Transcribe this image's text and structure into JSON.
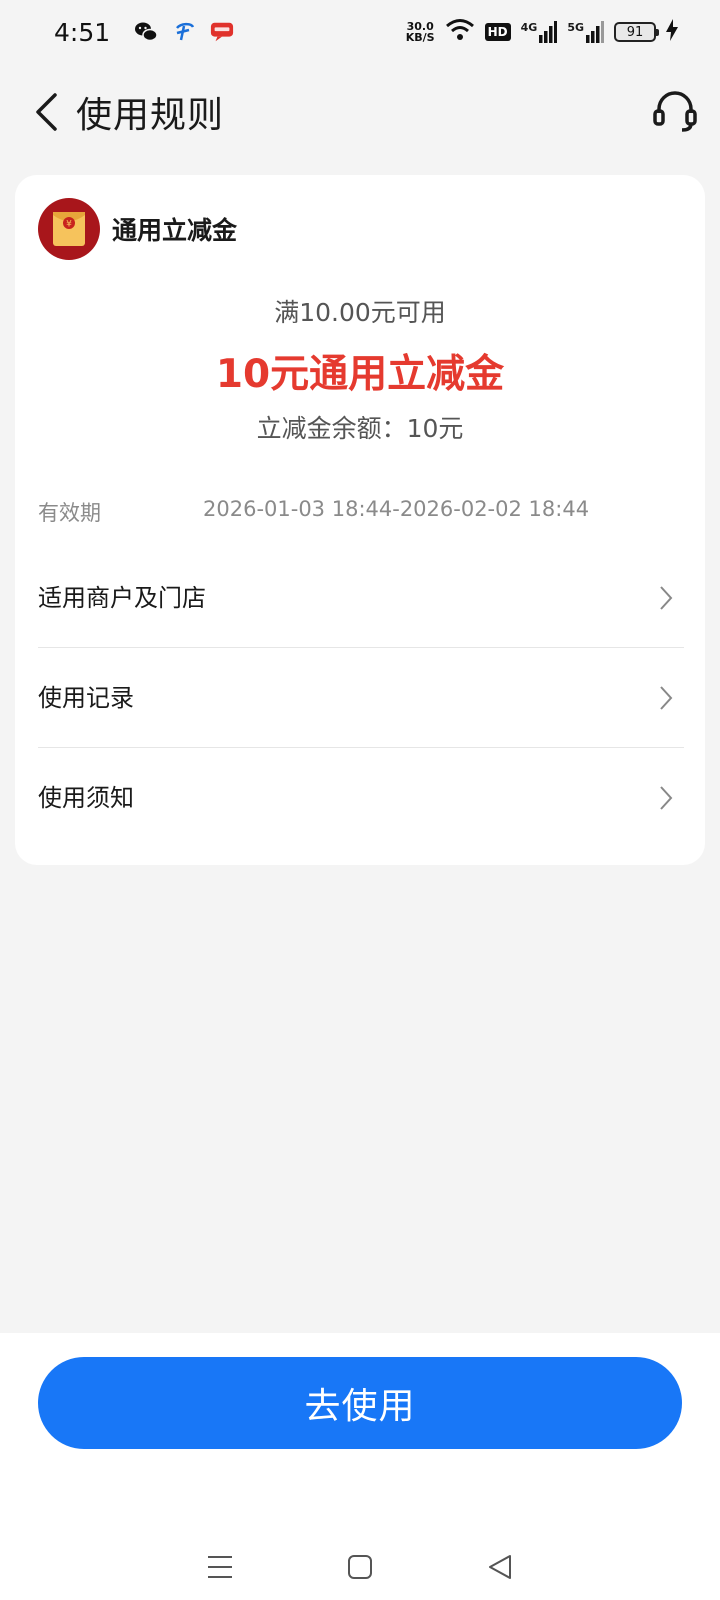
{
  "status_bar": {
    "time": "4:51",
    "app_icons": [
      "wechat-icon",
      "telecom-icon",
      "message-icon"
    ],
    "net_speed_value": "30.0",
    "net_speed_unit": "KB/S",
    "hd_badge": "HD",
    "signal_1": "4G",
    "signal_2": "5G",
    "battery": "91"
  },
  "header": {
    "title": "使用规则"
  },
  "coupon": {
    "name": "通用立减金",
    "threshold": "满10.00元可用",
    "amount_title": "10元通用立减金",
    "balance": "立减金余额：10元",
    "validity_label": "有效期",
    "validity_value": "2026-01-03 18:44-2026-02-02 18:44",
    "accent_color": "#e53a2f"
  },
  "menu": [
    {
      "label": "适用商户及门店"
    },
    {
      "label": "使用记录"
    },
    {
      "label": "使用须知"
    }
  ],
  "action": {
    "label": "去使用",
    "color": "#1877f7"
  }
}
